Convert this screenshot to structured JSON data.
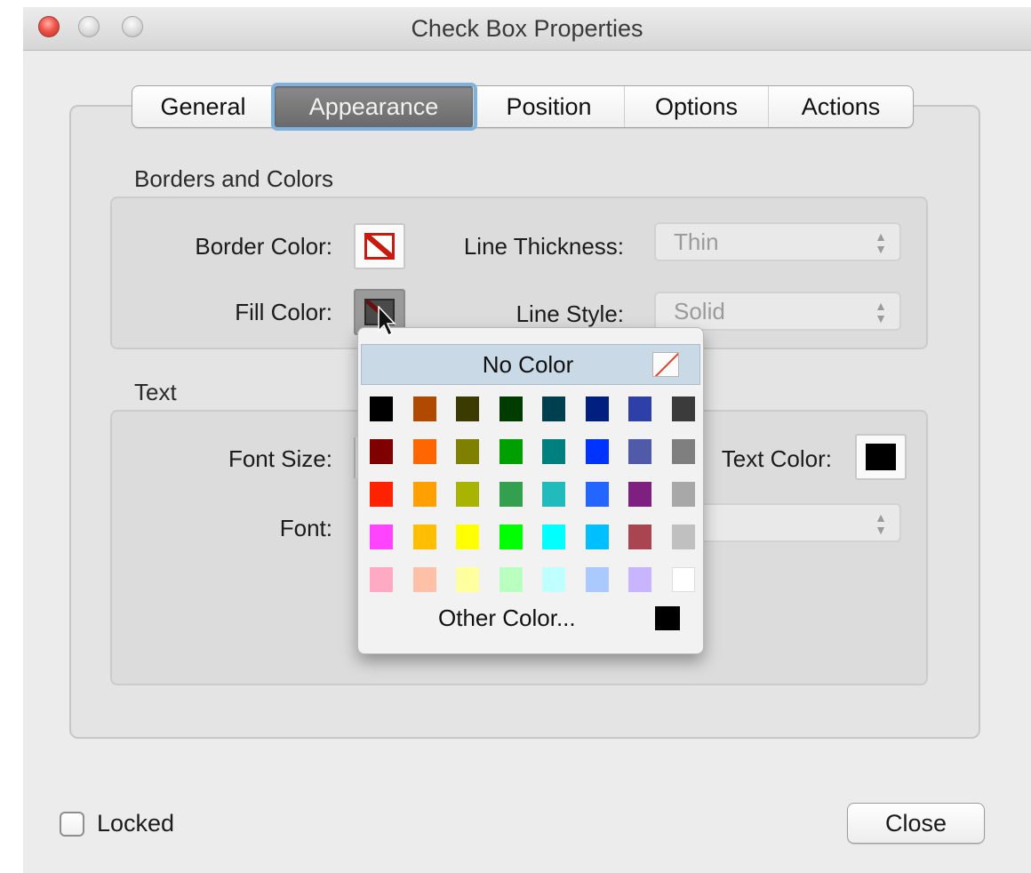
{
  "window": {
    "title": "Check Box Properties"
  },
  "tabs": [
    {
      "label": "General"
    },
    {
      "label": "Appearance",
      "active": true
    },
    {
      "label": "Position"
    },
    {
      "label": "Options"
    },
    {
      "label": "Actions"
    }
  ],
  "borders_section": {
    "heading": "Borders and Colors",
    "border_color_label": "Border Color:",
    "fill_color_label": "Fill Color:",
    "line_thickness_label": "Line Thickness:",
    "line_thickness_value": "Thin",
    "line_style_label": "Line Style:",
    "line_style_value": "Solid"
  },
  "text_section": {
    "heading": "Text",
    "font_size_label": "Font Size:",
    "font_label": "Font:",
    "text_color_label": "Text Color:",
    "text_color": "#000000"
  },
  "color_palette": {
    "no_color_label": "No Color",
    "other_color_label": "Other Color...",
    "other_color_swatch": "#000000",
    "rows": [
      [
        "#000000",
        "#b04a00",
        "#3b3b00",
        "#003b00",
        "#003f4f",
        "#001f7f",
        "#2f3fa8",
        "#3b3b3b"
      ],
      [
        "#7f0000",
        "#ff6600",
        "#7f7f00",
        "#009f00",
        "#007f7f",
        "#0033ff",
        "#4f5aa8",
        "#7f7f7f"
      ],
      [
        "#ff2200",
        "#ffa000",
        "#a8b400",
        "#33a050",
        "#22bbbb",
        "#2266ff",
        "#7f1f7f",
        "#a8a8a8"
      ],
      [
        "#ff44ff",
        "#ffbf00",
        "#ffff00",
        "#00ff00",
        "#00ffff",
        "#00bfff",
        "#aa4450",
        "#c0c0c0"
      ],
      [
        "#ffaac4",
        "#ffc0a8",
        "#ffff9f",
        "#b8ffc0",
        "#c0ffff",
        "#aacaff",
        "#c8b4ff",
        "#ffffff"
      ]
    ]
  },
  "footer": {
    "locked_label": "Locked",
    "close_label": "Close"
  }
}
